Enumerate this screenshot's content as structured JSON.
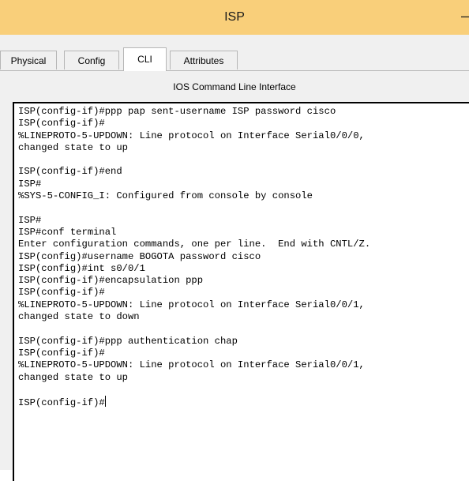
{
  "window": {
    "title": "ISP",
    "minimize_glyph": "–"
  },
  "tabs": [
    {
      "label": "Physical",
      "active": false
    },
    {
      "label": "Config",
      "active": false
    },
    {
      "label": "CLI",
      "active": true
    },
    {
      "label": "Attributes",
      "active": false
    }
  ],
  "cli": {
    "heading": "IOS Command Line Interface",
    "lines": [
      "ISP(config-if)#ppp pap sent-username ISP password cisco",
      "ISP(config-if)#",
      "%LINEPROTO-5-UPDOWN: Line protocol on Interface Serial0/0/0,",
      "changed state to up",
      "",
      "ISP(config-if)#end",
      "ISP#",
      "%SYS-5-CONFIG_I: Configured from console by console",
      "",
      "ISP#",
      "ISP#conf terminal",
      "Enter configuration commands, one per line.  End with CNTL/Z.",
      "ISP(config)#username BOGOTA password cisco",
      "ISP(config)#int s0/0/1",
      "ISP(config-if)#encapsulation ppp",
      "ISP(config-if)#",
      "%LINEPROTO-5-UPDOWN: Line protocol on Interface Serial0/0/1,",
      "changed state to down",
      "",
      "ISP(config-if)#ppp authentication chap",
      "ISP(config-if)#",
      "%LINEPROTO-5-UPDOWN: Line protocol on Interface Serial0/0/1,",
      "changed state to up",
      ""
    ],
    "prompt": "ISP(config-if)#"
  }
}
